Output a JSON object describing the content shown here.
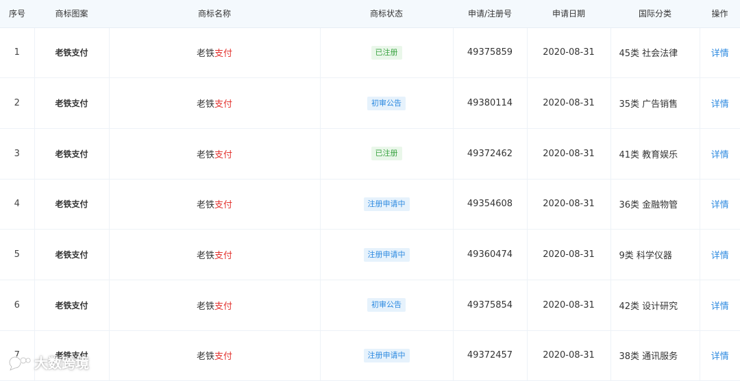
{
  "table": {
    "headers": [
      "序号",
      "商标图案",
      "商标名称",
      "商标状态",
      "申请/注册号",
      "申请日期",
      "国际分类",
      "操作"
    ],
    "rows": [
      {
        "index": "1",
        "pattern": "老铁支付",
        "name_a": "老铁",
        "name_b": "支付",
        "status": "已注册",
        "status_type": "registered",
        "reg_no": "49375859",
        "date": "2020-08-31",
        "cls": "45类 社会法律",
        "action": "详情"
      },
      {
        "index": "2",
        "pattern": "老铁支付",
        "name_a": "老铁",
        "name_b": "支付",
        "status": "初审公告",
        "status_type": "review",
        "reg_no": "49380114",
        "date": "2020-08-31",
        "cls": "35类 广告销售",
        "action": "详情"
      },
      {
        "index": "3",
        "pattern": "老铁支付",
        "name_a": "老铁",
        "name_b": "支付",
        "status": "已注册",
        "status_type": "registered",
        "reg_no": "49372462",
        "date": "2020-08-31",
        "cls": "41类 教育娱乐",
        "action": "详情"
      },
      {
        "index": "4",
        "pattern": "老铁支付",
        "name_a": "老铁",
        "name_b": "支付",
        "status": "注册申请中",
        "status_type": "pending",
        "reg_no": "49354608",
        "date": "2020-08-31",
        "cls": "36类 金融物管",
        "action": "详情"
      },
      {
        "index": "5",
        "pattern": "老铁支付",
        "name_a": "老铁",
        "name_b": "支付",
        "status": "注册申请中",
        "status_type": "pending",
        "reg_no": "49360474",
        "date": "2020-08-31",
        "cls": "9类 科学仪器",
        "action": "详情"
      },
      {
        "index": "6",
        "pattern": "老铁支付",
        "name_a": "老铁",
        "name_b": "支付",
        "status": "初审公告",
        "status_type": "review",
        "reg_no": "49375854",
        "date": "2020-08-31",
        "cls": "42类 设计研究",
        "action": "详情"
      },
      {
        "index": "7",
        "pattern": "老铁支付",
        "name_a": "老铁",
        "name_b": "支付",
        "status": "注册申请中",
        "status_type": "pending",
        "reg_no": "49372457",
        "date": "2020-08-31",
        "cls": "38类 通讯服务",
        "action": "详情"
      }
    ]
  },
  "colors": {
    "header_bg": "#f4f9fd",
    "name_highlight": "#e2312d",
    "link": "#2d8ae0",
    "status_registered": "#3aa341",
    "status_review": "#2d8ae0",
    "status_pending": "#2d8ae0"
  },
  "watermark": {
    "text": "大数跨境",
    "icon": "bubble-logo-icon"
  }
}
